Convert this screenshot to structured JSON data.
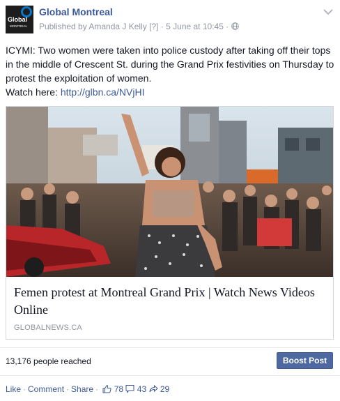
{
  "post": {
    "page_name": "Global Montreal",
    "logo_text": "Global",
    "logo_subtext": "MONTREAL",
    "published_by": "Published by Amanda J Kelly",
    "help_marker": "[?]",
    "date": "5 June at 10:45",
    "dot": "·",
    "text": "ICYMI: Two women were taken into police custody after taking off their tops in the middle of Crescent St. during the Grand Prix festivities on Thursday to protest the exploitation of women.",
    "watch_label": "Watch here:",
    "watch_link": "http://glbn.ca/NVjHI"
  },
  "preview": {
    "title": "Femen protest at Montreal Grand Prix | Watch News Videos Online",
    "domain": "GLOBALNEWS.CA"
  },
  "stats": {
    "reach": "13,176 people reached",
    "boost_label": "Boost Post"
  },
  "actions": {
    "like": "Like",
    "comment": "Comment",
    "share": "Share",
    "sep": "·",
    "likes_count": "78",
    "comments_count": "43",
    "shares_count": "29"
  },
  "colors": {
    "link": "#3b5998",
    "meta": "#9197a3",
    "boost_bg": "#4e69a2"
  },
  "icons": [
    "global-logo-icon",
    "globe-icon",
    "chevron-down-icon",
    "thumbs-up-icon",
    "comment-bubble-icon",
    "share-arrow-icon"
  ]
}
